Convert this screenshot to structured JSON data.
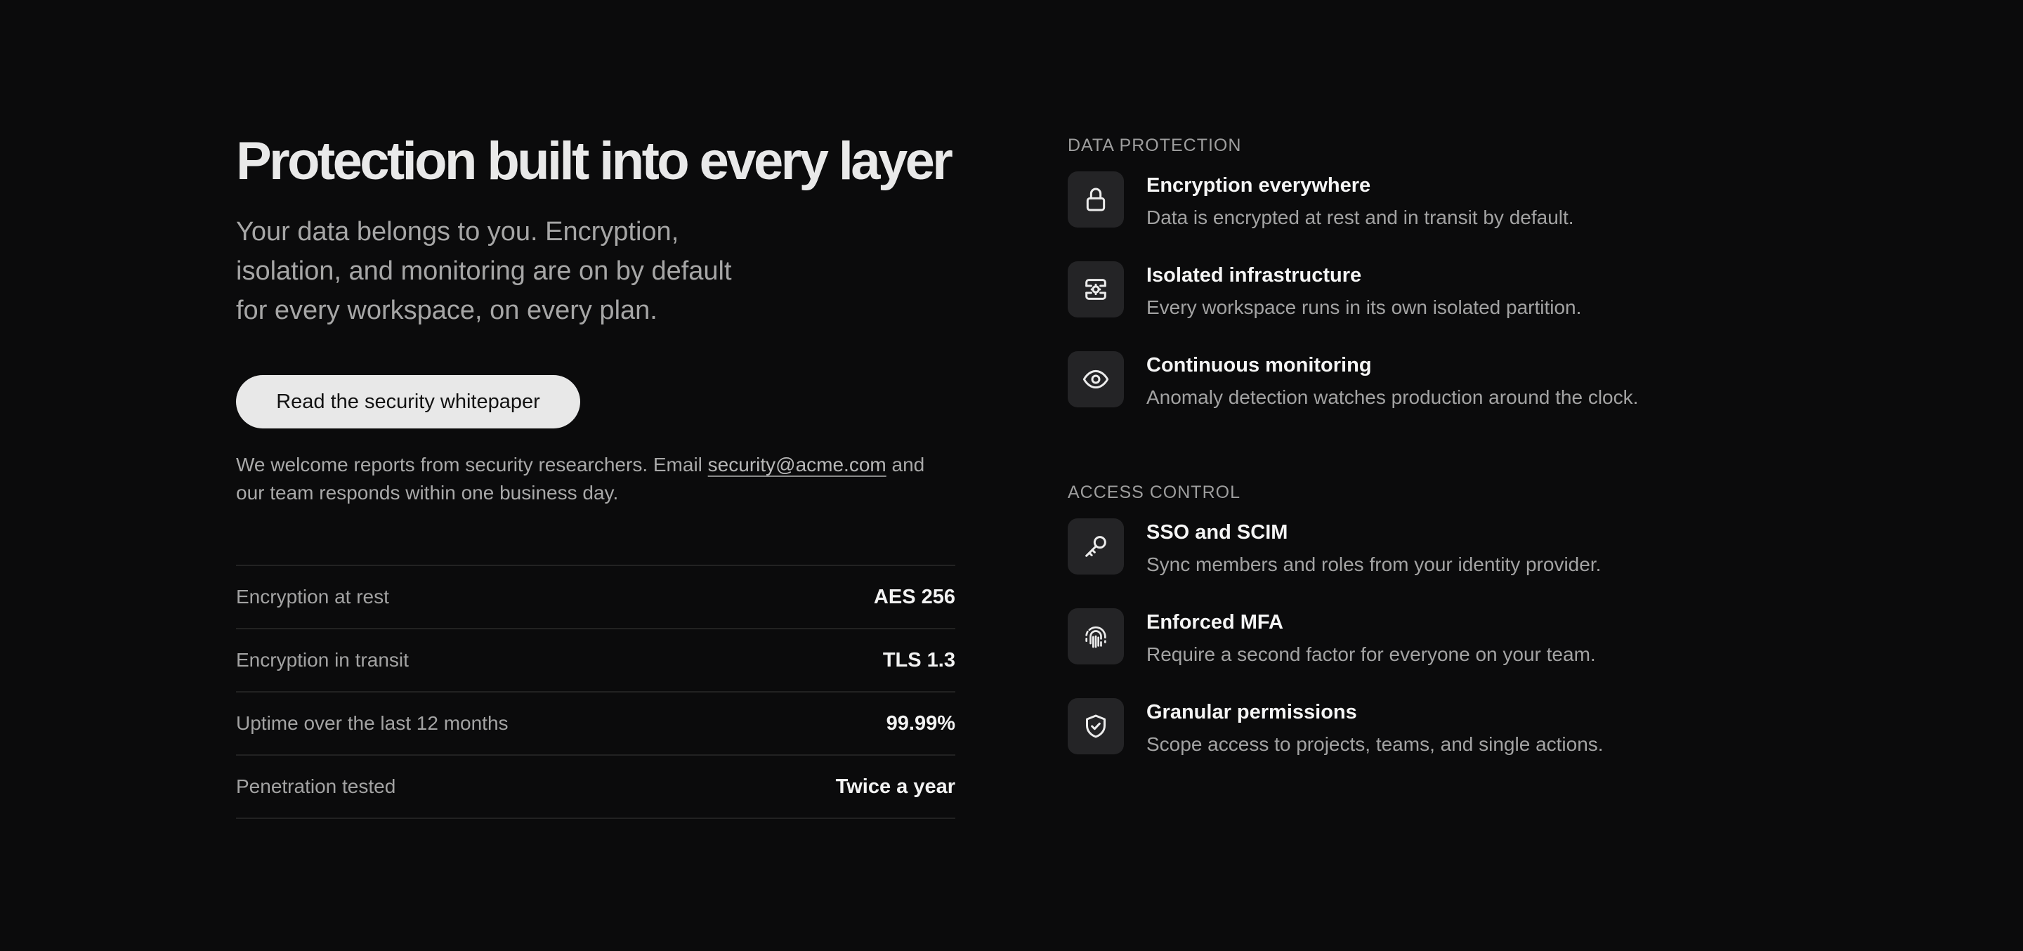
{
  "hero": {
    "title": "Protection built into every layer",
    "subtitle": "Your data belongs to you. Encryption, isolation, and monitoring are on by default for every workspace, on every plan.",
    "cta_label": "Read the security whitepaper",
    "reports_text_before": "We welcome reports from security researchers. Email ",
    "reports_email": "security@acme.com",
    "reports_text_after": " and our team responds within one business day."
  },
  "stats": [
    {
      "label": "Encryption at rest",
      "value": "AES 256"
    },
    {
      "label": "Encryption in transit",
      "value": "TLS 1.3"
    },
    {
      "label": "Uptime over the last 12 months",
      "value": "99.99%"
    },
    {
      "label": "Penetration tested",
      "value": "Twice a year"
    }
  ],
  "sections": [
    {
      "label": "DATA PROTECTION",
      "features": [
        {
          "icon": "lock-icon",
          "title": "Encryption everywhere",
          "description": "Data is encrypted at rest and in transit by default."
        },
        {
          "icon": "isolated-server-icon",
          "title": "Isolated infrastructure",
          "description": "Every workspace runs in its own isolated partition."
        },
        {
          "icon": "eye-icon",
          "title": "Continuous monitoring",
          "description": "Anomaly detection watches production around the clock."
        }
      ]
    },
    {
      "label": "ACCESS CONTROL",
      "features": [
        {
          "icon": "key-icon",
          "title": "SSO and SCIM",
          "description": "Sync members and roles from your identity provider."
        },
        {
          "icon": "fingerprint-icon",
          "title": "Enforced MFA",
          "description": "Require a second factor for everyone on your team."
        },
        {
          "icon": "shield-check-icon",
          "title": "Granular permissions",
          "description": "Scope access to projects, teams, and single actions."
        }
      ]
    }
  ],
  "colors": {
    "background": "#0b0b0c",
    "icon_tile": "#242426",
    "button": "#e8e8e8"
  }
}
